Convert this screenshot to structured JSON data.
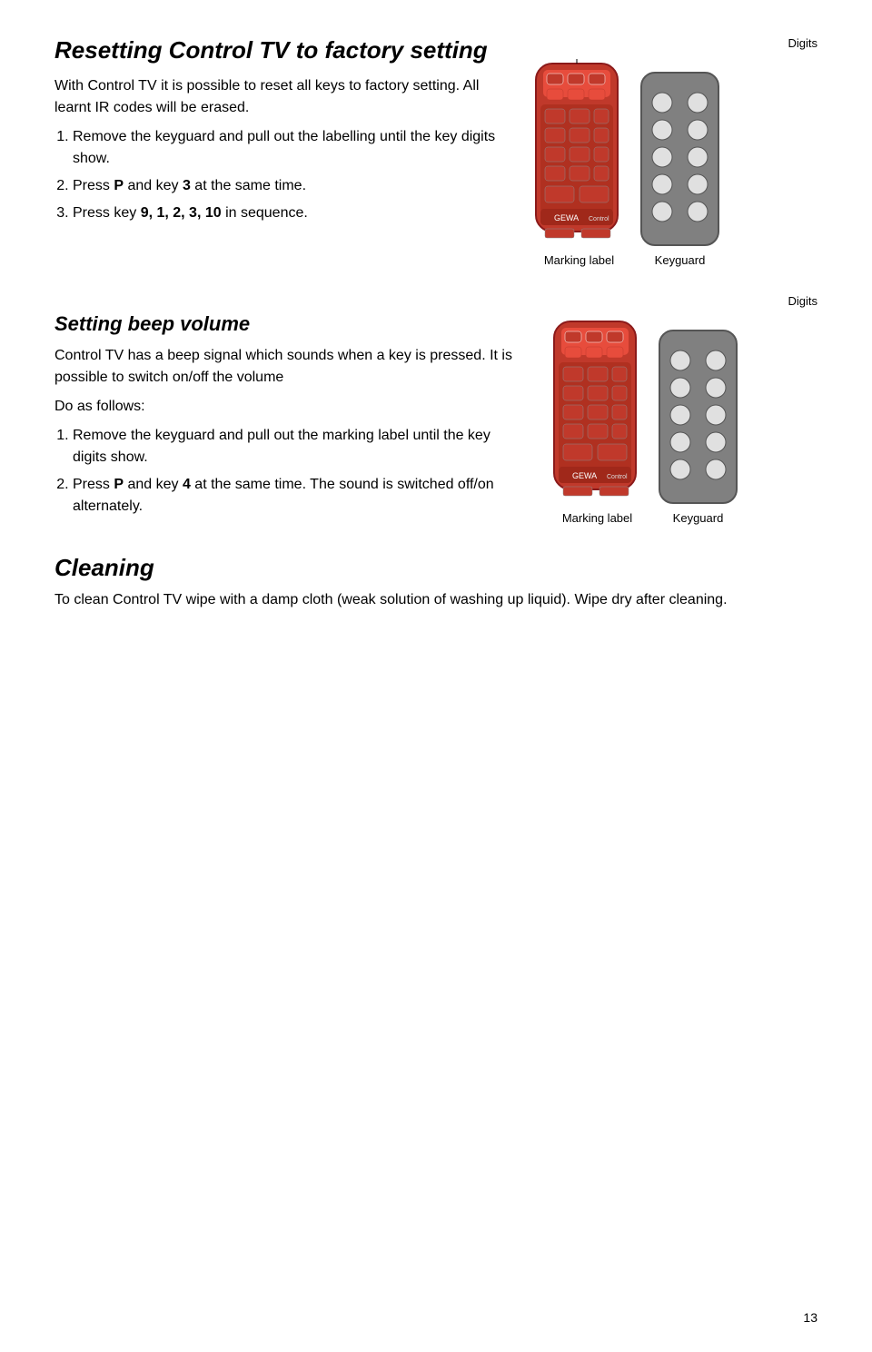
{
  "page": {
    "number": "13"
  },
  "reset_section": {
    "title": "Resetting Control TV to factory setting",
    "intro": "With Control TV it is possible to reset all keys to factory setting. All learnt IR codes will be erased.",
    "steps": [
      "Remove the keyguard and pull out the labelling until the key digits show.",
      "Press P and key 3 at the same time.",
      "Press key 9, 1, 2, 3, 10 in sequence."
    ],
    "step2_bold": "P",
    "step2_bold2": "3",
    "step3_bold": "9, 1, 2, 3, 10",
    "label_digits": "Digits",
    "label_marking": "Marking label",
    "label_keyguard": "Keyguard"
  },
  "beep_section": {
    "title": "Setting beep volume",
    "intro": "Control TV has a beep signal which sounds when a key is pressed. It is possible to switch on/off the volume",
    "do_as_follows": "Do as follows:",
    "steps": [
      "Remove the keyguard and pull out the marking label until the key digits show.",
      "Press P and key 4 at the same time. The sound is switched off/on alternately."
    ],
    "step2_bold": "P",
    "step2_bold2": "4",
    "label_digits": "Digits",
    "label_marking": "Marking label",
    "label_keyguard": "Keyguard"
  },
  "cleaning_section": {
    "title": "Cleaning",
    "text": "To clean Control TV wipe with a damp cloth (weak solution of washing up liquid). Wipe dry after cleaning."
  }
}
